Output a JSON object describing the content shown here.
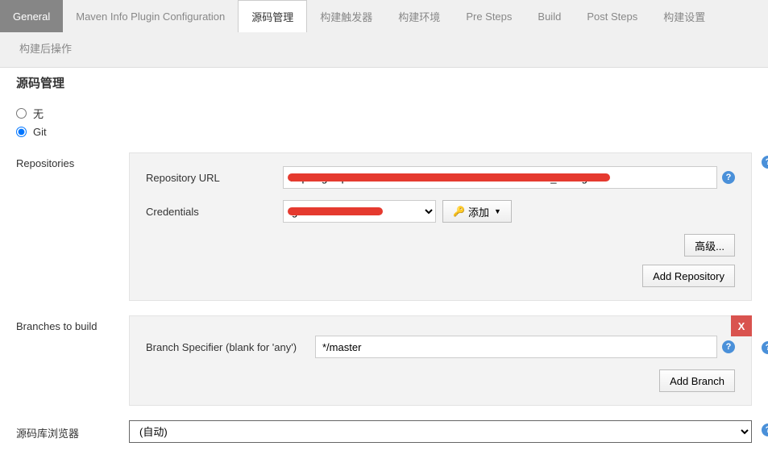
{
  "tabs": {
    "row1": [
      "General",
      "Maven Info Plugin Configuration",
      "源码管理",
      "构建触发器",
      "构建环境",
      "Pre Steps",
      "Build",
      "Post Steps",
      "构建设置"
    ],
    "row2": [
      "构建后操作"
    ],
    "active_dark": 0,
    "active_white": 2
  },
  "section_title": "源码管理",
  "scm": {
    "none_label": "无",
    "git_label": "Git",
    "selected": "git"
  },
  "repos": {
    "label": "Repositories",
    "url_label": "Repository URL",
    "url_value": "https://git.openserver.cn:0000/blockchain/eth/Tud...Scan_Java.git",
    "cred_label": "Credentials",
    "cred_value": "g/******",
    "add_label": "添加",
    "advanced_label": "高级...",
    "add_repo_label": "Add Repository"
  },
  "branches": {
    "label": "Branches to build",
    "spec_label": "Branch Specifier (blank for 'any')",
    "spec_value": "*/master",
    "add_branch_label": "Add Branch",
    "close": "X"
  },
  "browser": {
    "label": "源码库浏览器",
    "value": "(自动)"
  },
  "help_glyph": "?"
}
